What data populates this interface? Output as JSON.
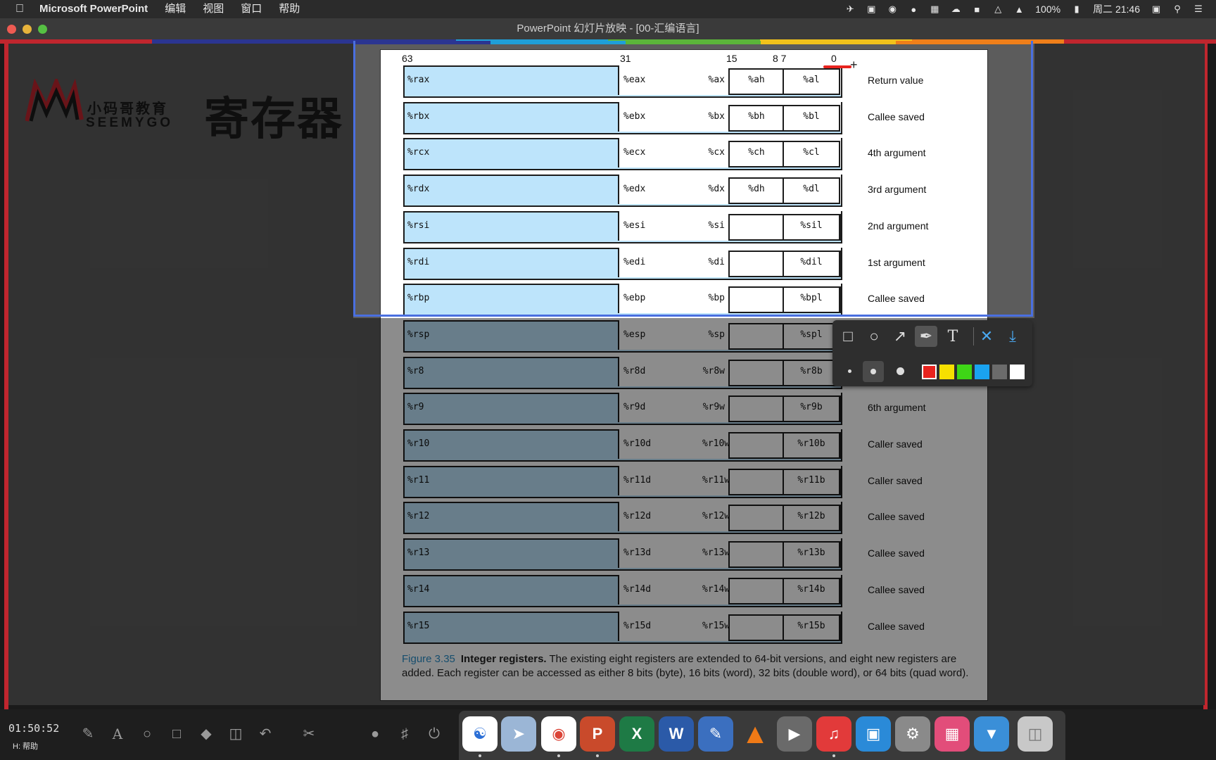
{
  "menubar": {
    "app_name": "Microsoft PowerPoint",
    "menus": [
      "编辑",
      "视图",
      "窗口",
      "帮助"
    ],
    "battery": "100%",
    "clock": "周二 21:46"
  },
  "window": {
    "title": "PowerPoint 幻灯片放映 - [00-汇编语言]"
  },
  "slide": {
    "logo_cn": "小码哥教育",
    "logo_en": "SEEMYGO",
    "title": "寄存器"
  },
  "figure": {
    "bit_labels": [
      "63",
      "31",
      "15",
      "8 7",
      "0"
    ],
    "registers": [
      {
        "r64": "%rax",
        "r32": "%eax",
        "r16": "%ax",
        "r8h": "%ah",
        "r8l": "%al",
        "use": "Return value"
      },
      {
        "r64": "%rbx",
        "r32": "%ebx",
        "r16": "%bx",
        "r8h": "%bh",
        "r8l": "%bl",
        "use": "Callee saved"
      },
      {
        "r64": "%rcx",
        "r32": "%ecx",
        "r16": "%cx",
        "r8h": "%ch",
        "r8l": "%cl",
        "use": "4th argument"
      },
      {
        "r64": "%rdx",
        "r32": "%edx",
        "r16": "%dx",
        "r8h": "%dh",
        "r8l": "%dl",
        "use": "3rd argument"
      },
      {
        "r64": "%rsi",
        "r32": "%esi",
        "r16": "%si",
        "r8h": "",
        "r8l": "%sil",
        "use": "2nd argument"
      },
      {
        "r64": "%rdi",
        "r32": "%edi",
        "r16": "%di",
        "r8h": "",
        "r8l": "%dil",
        "use": "1st argument"
      },
      {
        "r64": "%rbp",
        "r32": "%ebp",
        "r16": "%bp",
        "r8h": "",
        "r8l": "%bpl",
        "use": "Callee saved"
      },
      {
        "r64": "%rsp",
        "r32": "%esp",
        "r16": "%sp",
        "r8h": "",
        "r8l": "%spl",
        "use": ""
      },
      {
        "r64": "%r8",
        "r32": "%r8d",
        "r16": "%r8w",
        "r8h": "",
        "r8l": "%r8b",
        "use": ""
      },
      {
        "r64": "%r9",
        "r32": "%r9d",
        "r16": "%r9w",
        "r8h": "",
        "r8l": "%r9b",
        "use": "6th argument"
      },
      {
        "r64": "%r10",
        "r32": "%r10d",
        "r16": "%r10w",
        "r8h": "",
        "r8l": "%r10b",
        "use": "Caller saved"
      },
      {
        "r64": "%r11",
        "r32": "%r11d",
        "r16": "%r11w",
        "r8h": "",
        "r8l": "%r11b",
        "use": "Caller saved"
      },
      {
        "r64": "%r12",
        "r32": "%r12d",
        "r16": "%r12w",
        "r8h": "",
        "r8l": "%r12b",
        "use": "Callee saved"
      },
      {
        "r64": "%r13",
        "r32": "%r13d",
        "r16": "%r13w",
        "r8h": "",
        "r8l": "%r13b",
        "use": "Callee saved"
      },
      {
        "r64": "%r14",
        "r32": "%r14d",
        "r16": "%r14w",
        "r8h": "",
        "r8l": "%r14b",
        "use": "Callee saved"
      },
      {
        "r64": "%r15",
        "r32": "%r15d",
        "r16": "%r15w",
        "r8h": "",
        "r8l": "%r15b",
        "use": "Callee saved"
      }
    ],
    "caption_label": "Figure 3.35",
    "caption_bold": "Integer registers.",
    "caption_text": "The existing eight registers are extended to 64-bit versions, and eight new registers are added. Each register can be accessed as either 8 bits (byte), 16 bits (word), 32 bits (double word), or 64 bits (quad word)."
  },
  "annotation_toolbar": {
    "tools": [
      "rectangle-icon",
      "ellipse-icon",
      "arrow-icon",
      "brush-icon",
      "text-icon",
      "close-icon",
      "download-icon"
    ],
    "colors": [
      "#e8231e",
      "#f6e000",
      "#3ed616",
      "#1aa3f0",
      "#6b6b6b",
      "#ffffff"
    ]
  },
  "bottombar": {
    "timer": "01:50:52",
    "hint": "H: 帮助"
  }
}
